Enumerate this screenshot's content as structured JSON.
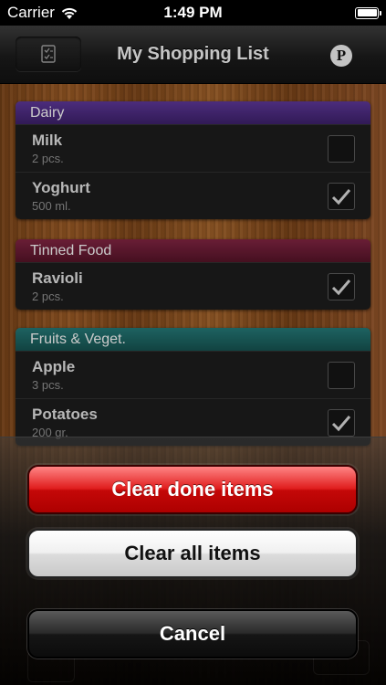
{
  "status_bar": {
    "carrier": "Carrier",
    "time": "1:49 PM"
  },
  "navbar": {
    "title": "My Shopping List",
    "right_button": "P"
  },
  "sections": [
    {
      "name": "Dairy",
      "color": "#4a2a7a",
      "items": [
        {
          "name": "Milk",
          "qty": "2 pcs.",
          "checked": false
        },
        {
          "name": "Yoghurt",
          "qty": "500 ml.",
          "checked": true
        }
      ]
    },
    {
      "name": "Tinned Food",
      "color": "#6a1a30",
      "items": [
        {
          "name": "Ravioli",
          "qty": "2 pcs.",
          "checked": true
        }
      ]
    },
    {
      "name": "Fruits & Veget.",
      "color": "#1b5c5a",
      "items": [
        {
          "name": "Apple",
          "qty": "3 pcs.",
          "checked": false
        },
        {
          "name": "Potatoes",
          "qty": "200 gr.",
          "checked": true
        }
      ]
    }
  ],
  "action_sheet": {
    "clear_done_label": "Clear done items",
    "clear_all_label": "Clear all items",
    "cancel_label": "Cancel"
  },
  "colors": {
    "destructive": "#d81414",
    "wood": "#8a4e20"
  }
}
